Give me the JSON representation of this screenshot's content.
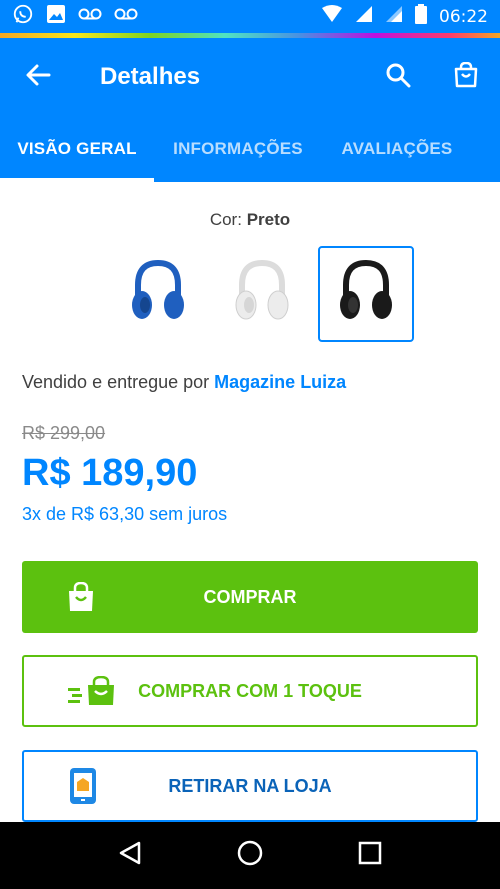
{
  "status_bar": {
    "time": "06:22"
  },
  "app_bar": {
    "title": "Detalhes"
  },
  "tabs": [
    {
      "label": "VISÃO GERAL",
      "active": true
    },
    {
      "label": "INFORMAÇÕES",
      "active": false
    },
    {
      "label": "AVALIAÇÕES",
      "active": false
    }
  ],
  "product": {
    "color_label": "Cor:",
    "color_value": "Preto",
    "color_options": [
      {
        "name": "blue-headphones",
        "color": "#1f5fbf"
      },
      {
        "name": "white-headphones",
        "color": "#e8e8e8"
      },
      {
        "name": "black-headphones",
        "color": "#1a1a1a",
        "selected": true
      }
    ],
    "seller_prefix": "Vendido e entregue por",
    "seller_name": "Magazine Luiza",
    "old_price": "R$ 299,00",
    "price": "R$ 189,90",
    "installments": "3x de R$ 63,30 sem juros"
  },
  "actions": {
    "buy_label": "COMPRAR",
    "quick_buy_label": "COMPRAR COM 1 TOQUE",
    "pickup_label": "RETIRAR NA LOJA"
  },
  "colors": {
    "primary_blue": "#0086ff",
    "buy_green": "#5cc10f",
    "store_blue": "#0a63b8"
  }
}
